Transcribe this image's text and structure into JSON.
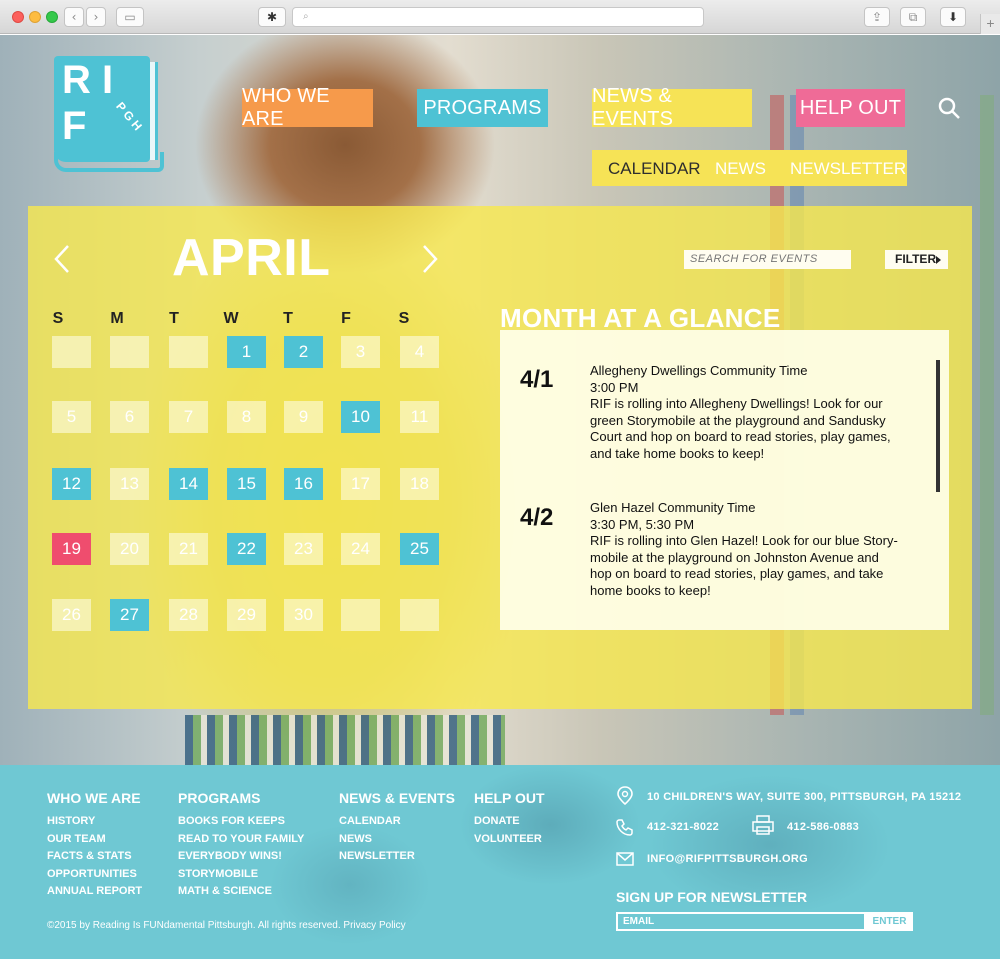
{
  "browser": {
    "url_placeholder": ""
  },
  "logo": {
    "line1": "R I",
    "letter_f": "F",
    "pgh": "P G H"
  },
  "nav": {
    "who": "WHO WE ARE",
    "programs": "PROGRAMS",
    "news": "NEWS & EVENTS",
    "help": "HELP OUT"
  },
  "subnav": {
    "calendar": "CALENDAR",
    "news": "NEWS",
    "newsletter": "NEWSLETTER"
  },
  "calendar": {
    "month": "APRIL",
    "days_of_week": [
      "S",
      "M",
      "T",
      "W",
      "T",
      "F",
      "S"
    ],
    "search_placeholder": "SEARCH FOR EVENTS",
    "filter_label": "FILTER",
    "weeks": [
      [
        {
          "d": "",
          "s": "empty"
        },
        {
          "d": "",
          "s": "empty"
        },
        {
          "d": "",
          "s": "empty"
        },
        {
          "d": "1",
          "s": "blue"
        },
        {
          "d": "2",
          "s": "blue"
        },
        {
          "d": "3",
          "s": "pale"
        },
        {
          "d": "4",
          "s": "pale"
        }
      ],
      [
        {
          "d": "5",
          "s": "pale"
        },
        {
          "d": "6",
          "s": "pale"
        },
        {
          "d": "7",
          "s": "pale"
        },
        {
          "d": "8",
          "s": "pale"
        },
        {
          "d": "9",
          "s": "pale"
        },
        {
          "d": "10",
          "s": "blue"
        },
        {
          "d": "11",
          "s": "pale"
        }
      ],
      [
        {
          "d": "12",
          "s": "blue"
        },
        {
          "d": "13",
          "s": "pale"
        },
        {
          "d": "14",
          "s": "blue"
        },
        {
          "d": "15",
          "s": "blue"
        },
        {
          "d": "16",
          "s": "blue"
        },
        {
          "d": "17",
          "s": "pale"
        },
        {
          "d": "18",
          "s": "pale"
        }
      ],
      [
        {
          "d": "19",
          "s": "red"
        },
        {
          "d": "20",
          "s": "pale"
        },
        {
          "d": "21",
          "s": "pale"
        },
        {
          "d": "22",
          "s": "blue"
        },
        {
          "d": "23",
          "s": "pale"
        },
        {
          "d": "24",
          "s": "pale"
        },
        {
          "d": "25",
          "s": "blue"
        }
      ],
      [
        {
          "d": "26",
          "s": "pale"
        },
        {
          "d": "27",
          "s": "blue"
        },
        {
          "d": "28",
          "s": "pale"
        },
        {
          "d": "29",
          "s": "pale"
        },
        {
          "d": "30",
          "s": "pale"
        },
        {
          "d": "",
          "s": "empty"
        },
        {
          "d": "",
          "s": "empty"
        }
      ]
    ]
  },
  "glance": {
    "title": "MONTH AT A GLANCE",
    "events": [
      {
        "date": "4/1",
        "title": "Allegheny Dwellings Community Time",
        "time": "3:00 PM",
        "desc_lines": [
          "RIF is rolling into Allegheny Dwellings! Look for our",
          "green Storymobile at the playground and Sandusky",
          "Court and hop on board to read stories, play games,",
          "and take home books to keep!"
        ]
      },
      {
        "date": "4/2",
        "title": "Glen Hazel Community Time",
        "time": "3:30 PM, 5:30 PM",
        "desc_lines": [
          "RIF is rolling into Glen Hazel! Look for our blue Story-",
          "mobile at the playground on Johnston Avenue and",
          "hop on board to read stories, play games, and take",
          "home books to keep!"
        ]
      }
    ]
  },
  "footer": {
    "who": {
      "head": "WHO WE ARE",
      "links": [
        "HISTORY",
        "OUR TEAM",
        "FACTS & STATS",
        "OPPORTUNITIES",
        "ANNUAL REPORT"
      ]
    },
    "programs": {
      "head": "PROGRAMS",
      "links": [
        "BOOKS FOR KEEPS",
        "READ TO YOUR FAMILY",
        "EVERYBODY WINS!",
        "STORYMOBILE",
        "MATH & SCIENCE"
      ]
    },
    "news": {
      "head": "NEWS & EVENTS",
      "links": [
        "CALENDAR",
        "NEWS",
        "NEWSLETTER"
      ]
    },
    "help": {
      "head": "HELP OUT",
      "links": [
        "DONATE",
        "VOLUNTEER"
      ]
    },
    "address": "10 CHILDREN'S WAY, SUITE 300, PITTSBURGH, PA 15212",
    "phone": "412-321-8022",
    "fax": "412-586-0883",
    "email": "INFO@RIFPITTSBURGH.ORG",
    "newsletter_head": "SIGN UP FOR NEWSLETTER",
    "email_placeholder": "EMAIL",
    "enter_label": "ENTER",
    "copyright": "©2015 by Reading Is FUNdamental Pittsburgh. All rights reserved. Privacy Policy"
  },
  "colors": {
    "orange": "#f69a4b",
    "teal": "#4ec2d4",
    "yellow": "#f6e356",
    "pink": "#ef6b97",
    "red": "#ef4d6e",
    "footer": "#6fc8d3"
  }
}
